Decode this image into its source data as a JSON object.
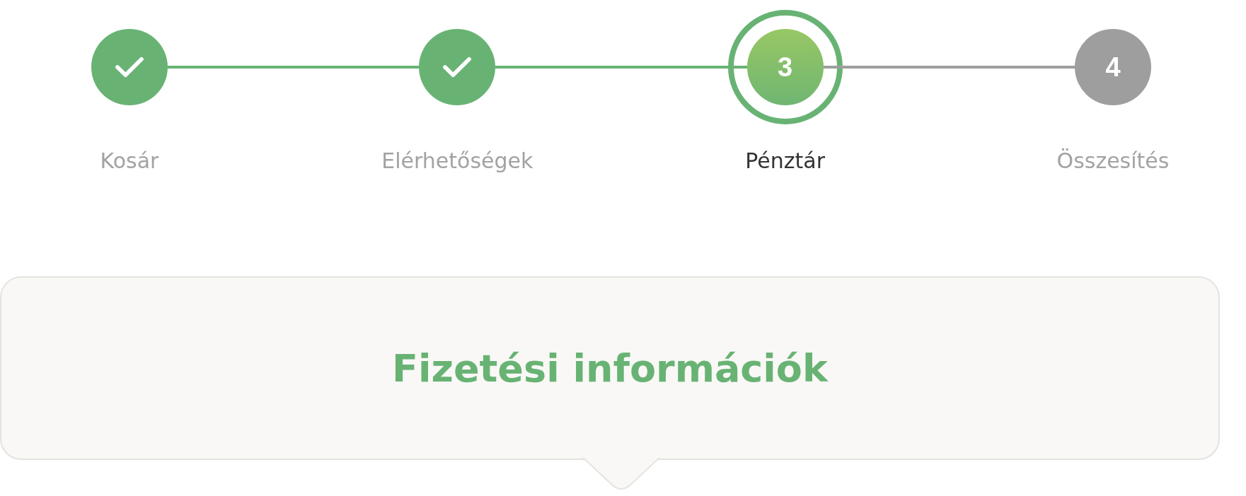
{
  "steps": [
    {
      "label": "Kosár",
      "kind": "done"
    },
    {
      "label": "Elérhetőségek",
      "kind": "done"
    },
    {
      "label": "Pénztár",
      "kind": "active",
      "number": "3"
    },
    {
      "label": "Összesítés",
      "kind": "upcoming",
      "number": "4"
    }
  ],
  "panel": {
    "title": "Fizetési információk"
  }
}
